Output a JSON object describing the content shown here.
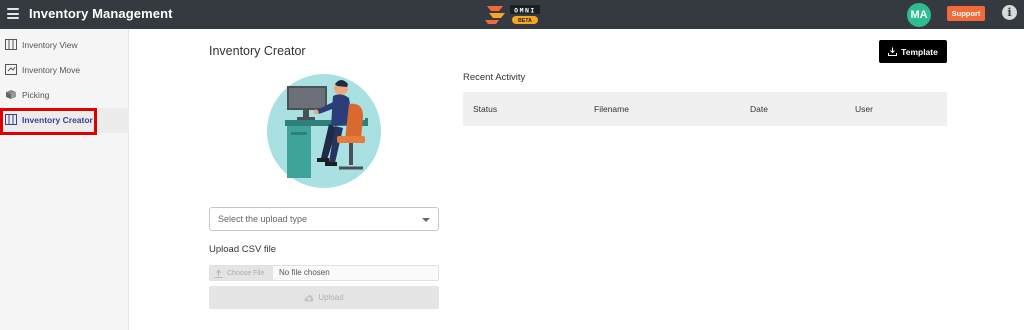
{
  "header": {
    "menu_icon": "hamburger-icon",
    "app_title": "Inventory Management",
    "logo_text": "OMNI",
    "logo_badge": "BETA",
    "avatar_initials": "MA",
    "support_label": "Support",
    "info_icon": "info-icon",
    "colors": {
      "bar": "#353a40",
      "avatar": "#2dbd8e",
      "support": "#f26a3a"
    }
  },
  "sidebar": {
    "items": [
      {
        "label": "Inventory View",
        "icon": "inventory-view-icon",
        "active": false
      },
      {
        "label": "Inventory Move",
        "icon": "inventory-move-icon",
        "active": false
      },
      {
        "label": "Picking",
        "icon": "picking-icon",
        "active": false
      },
      {
        "label": "Inventory Creator",
        "icon": "inventory-creator-icon",
        "active": true
      }
    ]
  },
  "main": {
    "title": "Inventory Creator",
    "template_button": "Template",
    "recent_activity": {
      "title": "Recent Activity",
      "columns": [
        "Status",
        "Filename",
        "Date",
        "User"
      ]
    },
    "upload_type": {
      "placeholder": "Select the upload type"
    },
    "upload_csv_label": "Upload CSV file",
    "file_input": {
      "button": "Choose File",
      "status": "No file chosen"
    },
    "upload_button": "Upload"
  }
}
